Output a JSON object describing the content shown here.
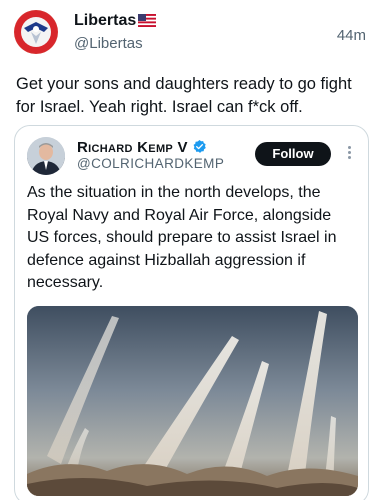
{
  "post": {
    "author_name": "Libertas",
    "author_handle": "@Libertas",
    "time_ago": "44m",
    "flag_icon": "us-flag-icon",
    "text": "Get your sons and daughters ready to go fight for Israel. Yeah right. Israel can f*ck off."
  },
  "quoted_post": {
    "author_name": "Richard Kemp V",
    "author_handle": "@COLRICHARDKEMP",
    "verified_icon": "verified-badge-icon",
    "follow_label": "Follow",
    "text": "As the situation in the north develops, the Royal Navy and Royal Air Force, alongside US forces, should prepare to assist Israel in defence against Hizballah aggression if necessary.",
    "media": {
      "type": "photo",
      "description_icon": "missile-launch-image"
    }
  },
  "colors": {
    "text_primary": "#0f1419",
    "text_secondary": "#536471",
    "border": "#cfd9de",
    "verified_blue": "#1d9bf0",
    "follow_bg": "#0f1419"
  }
}
